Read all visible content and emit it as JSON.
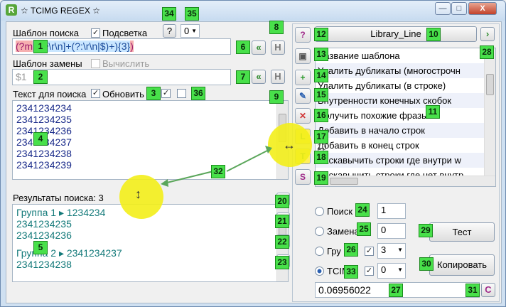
{
  "window": {
    "title": "☆ TCIMG REGEX ☆",
    "min_label": "—",
    "max_label": "□",
    "close_label": "X",
    "app_icon": "R"
  },
  "top": {
    "help_label": "?",
    "select_value": "0"
  },
  "pattern": {
    "label": "Шаблон поиска",
    "highlight_label": "Подсветка",
    "value_p1": "(?m",
    "value_p2": "?:[^\\r\\n]+(?:\\r\\n|$)+){3}",
    "value_close": ")"
  },
  "replace": {
    "label": "Шаблон замены",
    "compute_label": "Вычислить",
    "value": "$1"
  },
  "text": {
    "label": "Текст для поиска",
    "update_label": "Обновить",
    "lines": [
      "2341234234",
      "2341234235",
      "2341234236",
      "2341234237",
      "2341234238",
      "2341234239"
    ]
  },
  "results": {
    "label": "Результаты поиска: 3",
    "g1": "Группа 1 ▸ 1234234",
    "g1a": "2341234235",
    "g1b": "2341234236",
    "g2": "Группа 2 ▸ 2341234237",
    "g2a": "2341234238"
  },
  "library": {
    "button_label": "Library_Line",
    "header": "Название шаблона",
    "row_index_label": "10",
    "items": [
      "Удалить дубликаты (многострочн",
      "Удалить дубликаты (в строке)",
      "Внутренности конечных скобок",
      "Получить похожие фразы",
      "Добавить в начало строк",
      "Добавить в конец строк",
      "Раскавычить строки где внутри w",
      "Раскавычить строки где нет внутр"
    ]
  },
  "modes": {
    "search": "Поиск",
    "search_count": "1",
    "replace": "Замена",
    "replace_count": "0",
    "group": "Гру",
    "group_select": "3",
    "tcimg": "TCIM",
    "tcimg_select": "0"
  },
  "buttons": {
    "test": "Тест",
    "copy": "Копировать",
    "h": "H",
    "h2": "H",
    "c": "C"
  },
  "output": {
    "value": "0.06956022"
  },
  "badges": {
    "b1": "1",
    "b2": "2",
    "b3": "3",
    "b4": "4",
    "b5": "5",
    "b6": "6",
    "b7": "7",
    "b8": "8",
    "b9": "9",
    "b10": "10",
    "b11": "11",
    "b12": "12",
    "b13": "13",
    "b14": "14",
    "b15": "15",
    "b16": "16",
    "b17": "17",
    "b18": "18",
    "b19": "19",
    "b20": "20",
    "b21": "21",
    "b22": "22",
    "b23": "23",
    "b24": "24",
    "b25": "25",
    "b26": "26",
    "b27": "27",
    "b28": "28",
    "b29": "29",
    "b30": "30",
    "b31": "31",
    "b32": "32",
    "b33": "33",
    "b34": "34",
    "b35": "35",
    "b36": "36"
  },
  "colors": {
    "badge": "#48e04a",
    "highlight": "#f3ee1a",
    "accent_green": "#3aa33a",
    "library_header": "#ffffff"
  }
}
